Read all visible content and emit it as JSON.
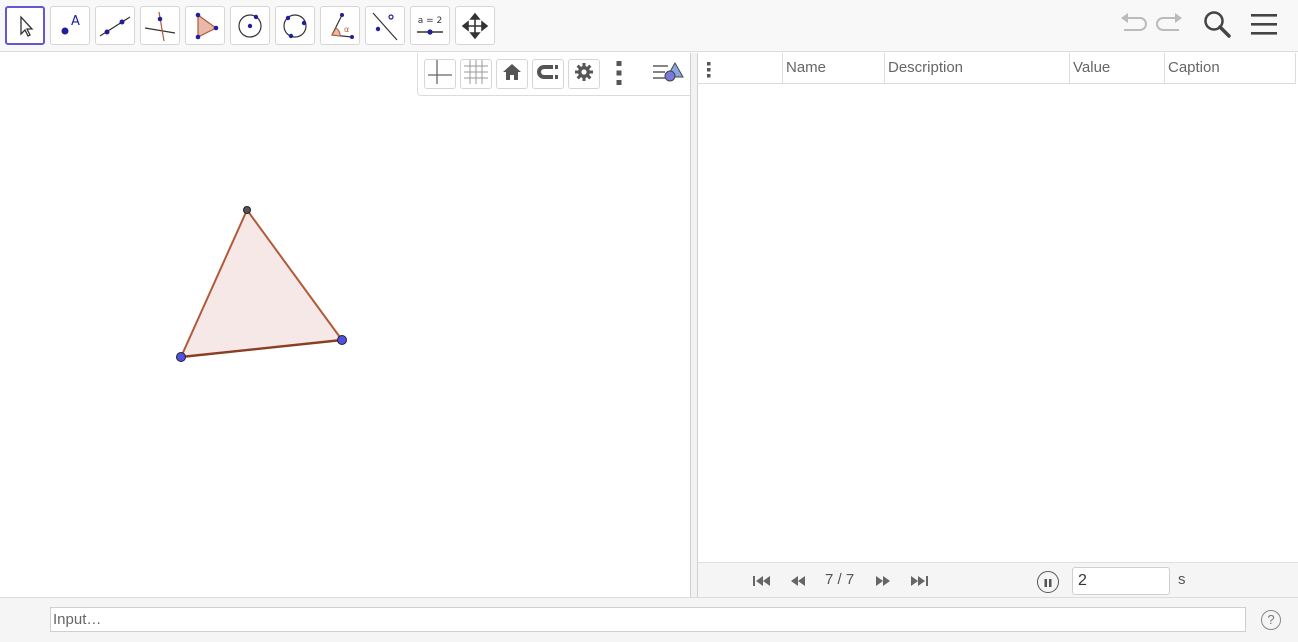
{
  "toolbar": {
    "tools": [
      {
        "name": "move-tool",
        "icon": "arrow-cursor-icon"
      },
      {
        "name": "point-tool",
        "icon": "point-icon",
        "label": "A"
      },
      {
        "name": "line-tool",
        "icon": "line-through-points-icon"
      },
      {
        "name": "perpendicular-line-tool",
        "icon": "perpendicular-line-icon"
      },
      {
        "name": "polygon-tool",
        "icon": "polygon-icon"
      },
      {
        "name": "circle-tool",
        "icon": "circle-center-point-icon"
      },
      {
        "name": "circle-three-points-tool",
        "icon": "circle-three-points-icon"
      },
      {
        "name": "angle-tool",
        "icon": "angle-icon"
      },
      {
        "name": "reflect-tool",
        "icon": "reflect-about-line-icon"
      },
      {
        "name": "slider-tool",
        "icon": "slider-icon",
        "label": "a = 2"
      },
      {
        "name": "move-graphics-view-tool",
        "icon": "move-view-icon"
      }
    ],
    "right_icons": [
      "undo-icon",
      "redo-icon",
      "search-icon",
      "menu-icon"
    ]
  },
  "style_bar": {
    "buttons": [
      "axes-icon",
      "grid-icon",
      "home-icon",
      "point-capturing-icon",
      "settings-icon",
      "more-vertical-icon",
      "style-bar-toggle-icon"
    ]
  },
  "triangle": {
    "fill": "#f5e8e6",
    "stroke": "#b05a3a",
    "vertex_color": "#5050e0"
  },
  "protocol": {
    "columns": [
      "Name",
      "Description",
      "Value",
      "Caption"
    ],
    "step_count": "7 / 7",
    "speed_value": "2",
    "speed_unit": "s"
  },
  "input_bar": {
    "placeholder": "Input…",
    "help_label": "?"
  },
  "colors": {
    "accent": "#6557d2",
    "toolbar_bg": "#f8f8f8"
  }
}
